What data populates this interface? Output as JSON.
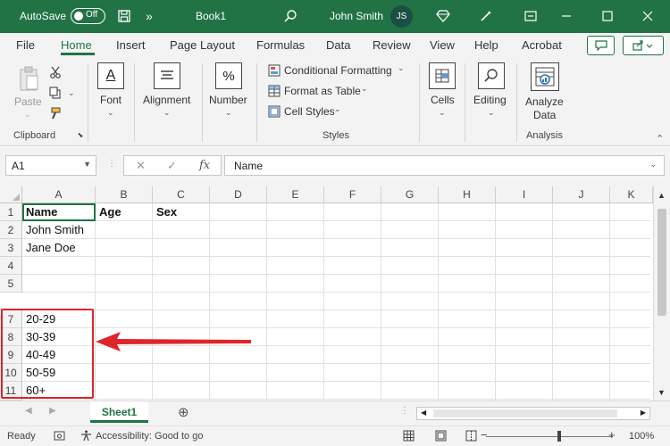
{
  "colors": {
    "brand": "#217346",
    "annotation_red": "#e0242b"
  },
  "titlebar": {
    "autosave_label": "AutoSave",
    "autosave_state": "Off",
    "doc_name": "Book1",
    "user_name": "John Smith",
    "user_initials": "JS",
    "more_label": "»"
  },
  "menu": {
    "items": [
      "File",
      "Home",
      "Insert",
      "Page Layout",
      "Formulas",
      "Data",
      "Review",
      "View",
      "Help",
      "Acrobat"
    ],
    "active": "Home"
  },
  "ribbon": {
    "clipboard": {
      "paste": "Paste",
      "label": "Clipboard"
    },
    "font": "Font",
    "alignment": "Alignment",
    "number": "Number",
    "number_icon": "%",
    "font_icon": "A",
    "styles": {
      "conditional": "Conditional Formatting",
      "format_table": "Format as Table",
      "cell_styles": "Cell Styles",
      "label": "Styles"
    },
    "cells": "Cells",
    "editing": "Editing",
    "analyze": {
      "line1": "Analyze",
      "line2": "Data",
      "label": "Analysis"
    }
  },
  "formula_bar": {
    "name_box": "A1",
    "fx": "fx",
    "content": "Name"
  },
  "sheet": {
    "columns": [
      "A",
      "B",
      "C",
      "D",
      "E",
      "F",
      "G",
      "H",
      "I",
      "J",
      "K"
    ],
    "rows": [
      "1",
      "2",
      "3",
      "4",
      "5",
      "7",
      "8",
      "9",
      "10",
      "11"
    ],
    "row1": {
      "a": "Name",
      "b": "Age",
      "c": "Sex"
    },
    "row2": {
      "a": "John Smith"
    },
    "row3": {
      "a": "Jane Doe"
    },
    "row7": {
      "a": "20-29"
    },
    "row8": {
      "a": "30-39"
    },
    "row9": {
      "a": "40-49"
    },
    "row10": {
      "a": "50-59"
    },
    "row11": {
      "a": "60+"
    }
  },
  "tabs": {
    "sheet1": "Sheet1",
    "add": "⊕"
  },
  "status": {
    "ready": "Ready",
    "accessibility": "Accessibility: Good to go",
    "zoom": "100%",
    "zoom_minus": "−",
    "zoom_plus": "+"
  }
}
